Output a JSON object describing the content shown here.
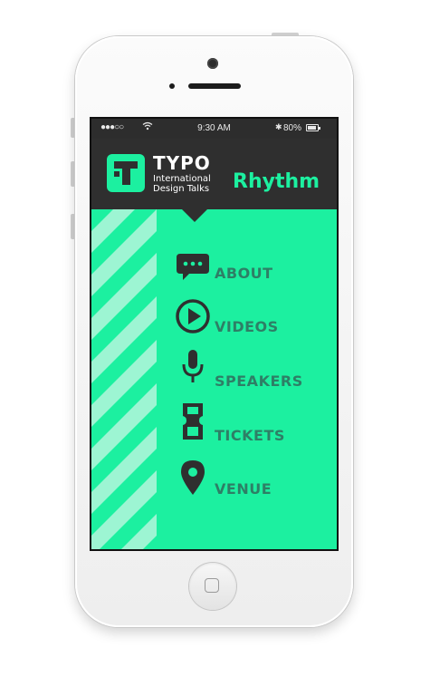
{
  "status_bar": {
    "signal": "●●●○○",
    "time": "9:30 AM",
    "battery": "80%"
  },
  "header": {
    "brand": "TYPO",
    "tagline_line1": "International",
    "tagline_line2": "Design Talks",
    "event": "Rhythm"
  },
  "menu": {
    "items": [
      {
        "label": "ABOUT",
        "icon": "chat-bubble-icon"
      },
      {
        "label": "VIDEOS",
        "icon": "play-icon"
      },
      {
        "label": "SPEAKERS",
        "icon": "microphone-icon"
      },
      {
        "label": "TICKETS",
        "icon": "ticket-icon"
      },
      {
        "label": "VENUE",
        "icon": "location-pin-icon"
      }
    ]
  },
  "colors": {
    "accent": "#1cf0a0",
    "header_bg": "#2f2f2f",
    "icon": "#2f2f2f",
    "label": "#2e7f66"
  }
}
